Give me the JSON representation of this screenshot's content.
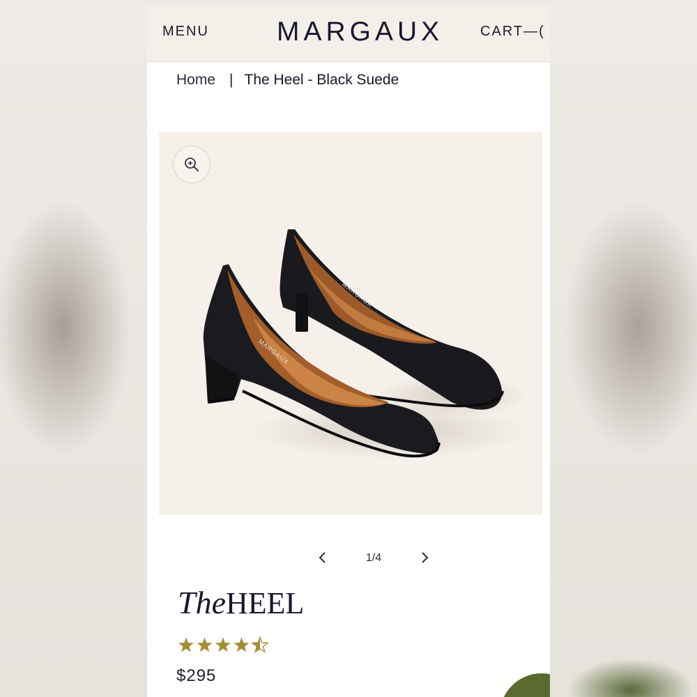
{
  "header": {
    "menu_label": "MENU",
    "logo": "MARGAUX",
    "cart_label": "CART—("
  },
  "breadcrumb": {
    "home": "Home",
    "separator": "|",
    "current": "The Heel - Black Suede"
  },
  "gallery": {
    "zoom_icon": "zoom-in-icon",
    "pager_text": "1/4",
    "prev_icon": "chevron-left-icon",
    "next_icon": "chevron-right-icon",
    "image_brand_mark": "MARGAUX"
  },
  "product": {
    "title_the": "The",
    "title_heel": "HEEL",
    "rating": 4.5,
    "rating_max": 5,
    "price": "$295"
  },
  "colors": {
    "header_bg": "#f4efe8",
    "navy_text": "#16182e",
    "star_gold": "#a38d34",
    "chat_green": "#5b6a2f"
  }
}
